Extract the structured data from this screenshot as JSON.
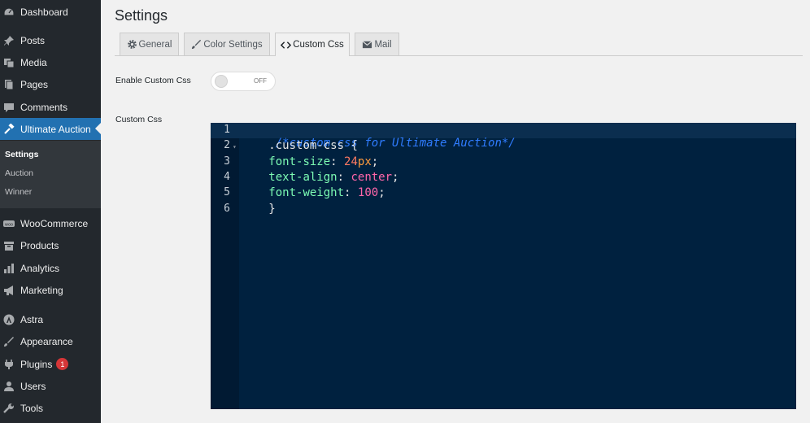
{
  "sidebar": {
    "items": [
      {
        "label": "Dashboard",
        "icon": "dashboard-icon"
      },
      {
        "label": "Posts",
        "icon": "pushpin-icon"
      },
      {
        "label": "Media",
        "icon": "media-icon"
      },
      {
        "label": "Pages",
        "icon": "pages-icon"
      },
      {
        "label": "Comments",
        "icon": "comment-icon"
      },
      {
        "label": "Ultimate Auction",
        "icon": "gavel-icon"
      },
      {
        "label": "WooCommerce",
        "icon": "woocommerce-icon"
      },
      {
        "label": "Products",
        "icon": "archive-icon"
      },
      {
        "label": "Analytics",
        "icon": "bar-chart-icon"
      },
      {
        "label": "Marketing",
        "icon": "megaphone-icon"
      },
      {
        "label": "Astra",
        "icon": "astra-icon"
      },
      {
        "label": "Appearance",
        "icon": "brush-icon"
      },
      {
        "label": "Plugins",
        "icon": "plugin-icon",
        "badge": "1"
      },
      {
        "label": "Users",
        "icon": "user-icon"
      },
      {
        "label": "Tools",
        "icon": "wrench-icon"
      }
    ],
    "submenu": [
      "Settings",
      "Auction",
      "Winner"
    ],
    "accent": "#2271b1"
  },
  "page": {
    "title": "Settings",
    "tabs": [
      {
        "label": "General",
        "icon": "gear-icon"
      },
      {
        "label": "Color Settings",
        "icon": "brush-icon"
      },
      {
        "label": "Custom Css",
        "icon": "code-icon"
      },
      {
        "label": "Mail",
        "icon": "mail-icon"
      }
    ],
    "enable_label": "Enable Custom Css",
    "toggle_text": "OFF",
    "custom_css_label": "Custom Css"
  },
  "editor": {
    "line_numbers": [
      "1",
      "2",
      "3",
      "4",
      "5",
      "6"
    ],
    "comment": "/*custom css for Ultimate Auction*/",
    "selector": ".custom-css {",
    "prop1": "font-size",
    "num1": "24",
    "unit1": "px",
    "prop2": "text-align",
    "val2": "center",
    "prop3": "font-weight",
    "num3": "100",
    "colon": ":",
    "semi": ";",
    "close": "}",
    "fold_marker": "▾",
    "background": "#00213f"
  }
}
